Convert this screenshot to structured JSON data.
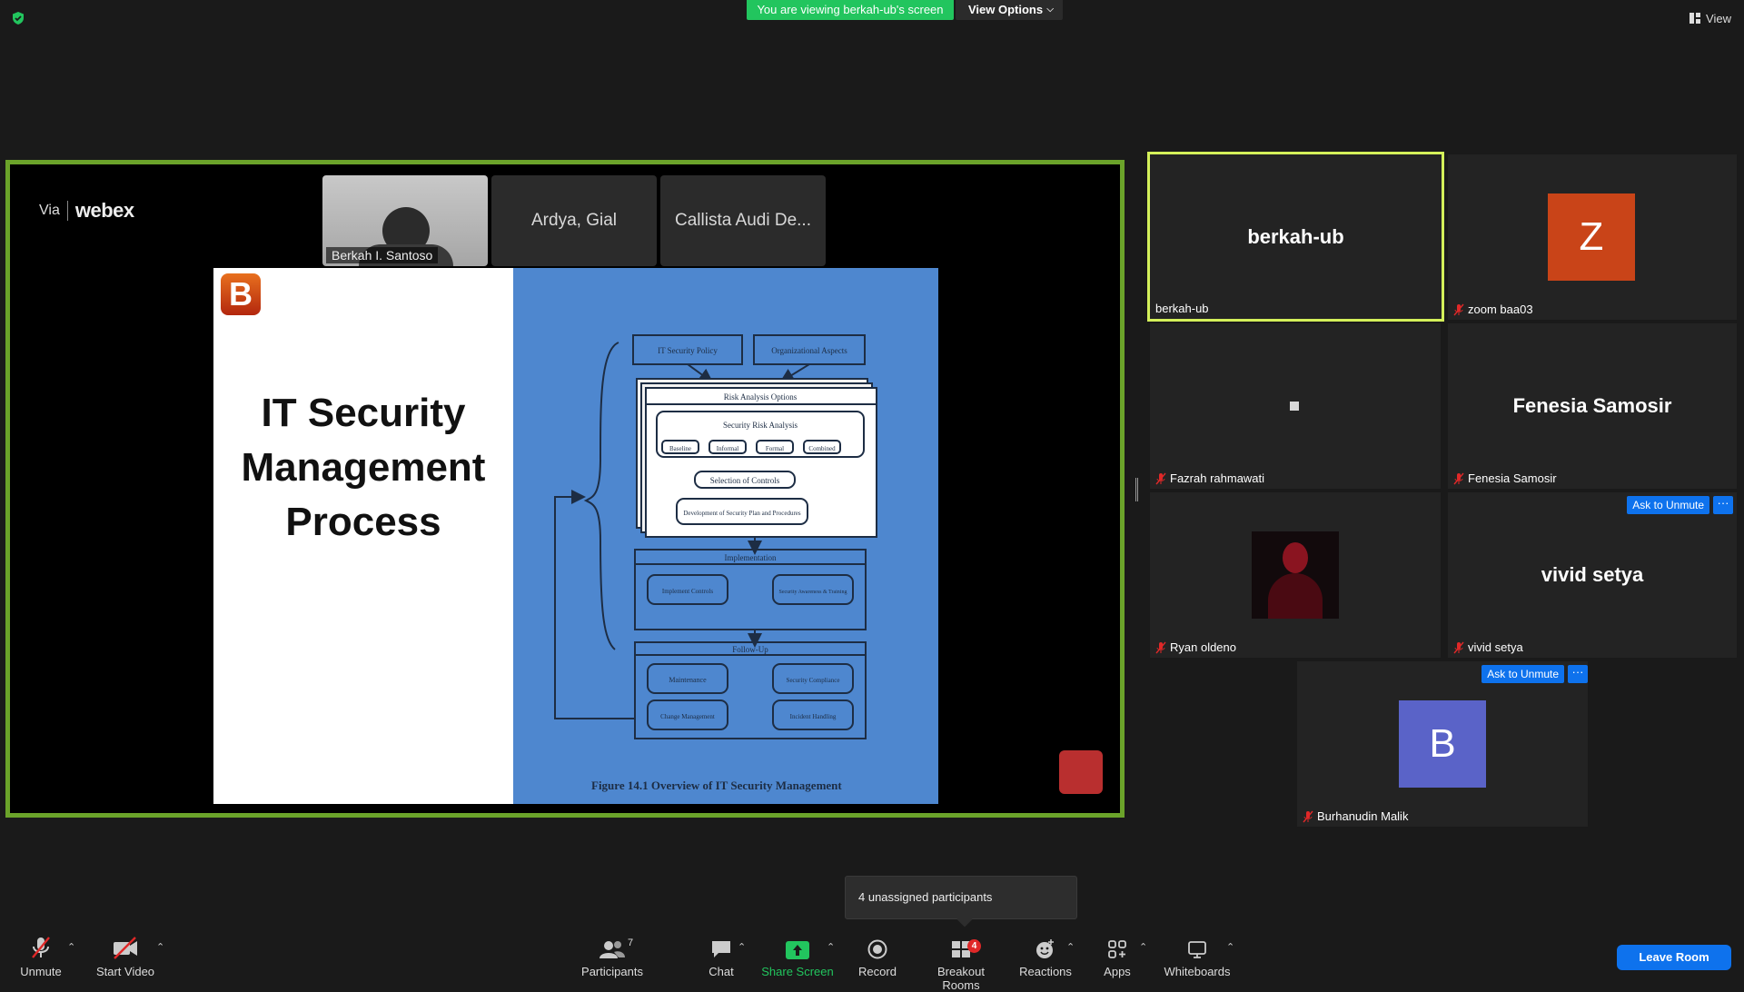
{
  "top": {
    "viewing_banner": "You are viewing berkah-ub's screen",
    "view_options": "View Options",
    "view_label": "View"
  },
  "share": {
    "webex_via": "Via",
    "webex_brand": "webex",
    "webex_tiles": [
      "Berkah I. Santoso",
      "Ardya, Gial",
      "Callista Audi De..."
    ],
    "slide_logo": "B",
    "slide_title": "IT Security\nManagement\nProcess",
    "diagram": {
      "top_boxes": [
        "IT Security Policy",
        "Organizational Aspects"
      ],
      "stack_title": "Risk Analysis Options",
      "risk_title": "Security Risk Analysis",
      "risk_options": [
        "Baseline",
        "Informal",
        "Formal",
        "Combined"
      ],
      "selection": "Selection of Controls",
      "development": "Development of Security Plan and Procedures",
      "implementation_title": "Implementation",
      "implementation_items": [
        "Implement Controls",
        "Security Awareness & Training"
      ],
      "followup_title": "Follow-Up",
      "followup_items": [
        "Maintenance",
        "Security Compliance",
        "Change Management",
        "Incident Handling"
      ]
    },
    "slide_caption": "Figure 14.1   Overview of IT Security Management"
  },
  "participants": [
    {
      "id": "berkah",
      "display": "berkah-ub",
      "label": "berkah-ub",
      "muted": false,
      "active": true
    },
    {
      "id": "zoom",
      "avatar": "Z",
      "avatar_color": "#c94418",
      "label": "zoom baa03",
      "muted": true
    },
    {
      "id": "fazrah",
      "label": "Fazrah rahmawati",
      "muted": true
    },
    {
      "id": "fenesia",
      "display": "Fenesia Samosir",
      "label": "Fenesia Samosir",
      "muted": true
    },
    {
      "id": "ryan",
      "label": "Ryan oldeno",
      "muted": true
    },
    {
      "id": "vivid",
      "display": "vivid setya",
      "label": "vivid setya",
      "muted": true,
      "ask_unmute": "Ask to Unmute"
    },
    {
      "id": "burhanudin",
      "avatar": "B",
      "avatar_color": "#5a63c8",
      "label": "Burhanudin Malik",
      "muted": true,
      "ask_unmute": "Ask to Unmute"
    }
  ],
  "more_label": "···",
  "tooltip": "4 unassigned participants",
  "toolbar": {
    "unmute": "Unmute",
    "start_video": "Start Video",
    "participants": "Participants",
    "participants_count": "7",
    "chat": "Chat",
    "share_screen": "Share Screen",
    "record": "Record",
    "breakout_rooms": "Breakout Rooms",
    "breakout_count": "4",
    "reactions": "Reactions",
    "apps": "Apps",
    "whiteboards": "Whiteboards",
    "leave_room": "Leave Room"
  },
  "colors": {
    "share_border": "#6ba32a",
    "active_speaker": "#d4f05a",
    "share_green": "#22c55e",
    "primary_blue": "#0e72ed"
  }
}
